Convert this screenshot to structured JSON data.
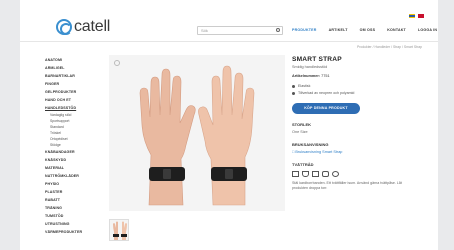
{
  "brand": {
    "logo_text": "catell"
  },
  "search": {
    "placeholder": "Sök"
  },
  "nav": [
    "PRODUKTER",
    "ARTIKELT",
    "OM OSS",
    "KONTAKT",
    "LOGGA IN"
  ],
  "breadcrumb": "Produkter / Handleder / Strap / Smart Strap",
  "sidebar": {
    "items_top": [
      "ANATOMI",
      "ARMLIGEL",
      "BARNARTIKLAR",
      "FINGER",
      "GELPRODUKTER",
      "HAND OCH ET"
    ],
    "active": "HANDLEDSSTÖD",
    "subitems": [
      "Vardaglig stöd",
      "Sportsupport",
      "Standard",
      "Tröskel",
      "Ortopédiset",
      "Stödge"
    ],
    "items_bottom": [
      "KNÄBANDAGER",
      "KNÄSKYDD",
      "MATERIAL",
      "NATTRÖMKLÄDER",
      "PHYSIO",
      "PLASTER",
      "RABATT",
      "TRÄNING",
      "TUMSTÖD",
      "UTRUSTNING",
      "VÄRMEPRODUKTER"
    ]
  },
  "product": {
    "title": "SMART STRAP",
    "subtitle": "Smidig handledsstöd",
    "artno_label": "Artikelnummer:",
    "artno_value": "7751",
    "bullets": [
      "Elastisk",
      "Tillverkad av neopren och polyamid"
    ],
    "buy_label": "KÖP DENNA PRODUKT",
    "size_title": "STORLEK",
    "size_value": "One Size",
    "manual_title": "BRUKSANVISNING",
    "manual_link": "Bruksanvisning Smart Strap",
    "care_title": "TVÄTTRÅD",
    "care_text": "Stäl kardborrbanden. Ett tvättfäller isum. Använd gärna tvättpåse. Låt produkten droppa torr."
  }
}
